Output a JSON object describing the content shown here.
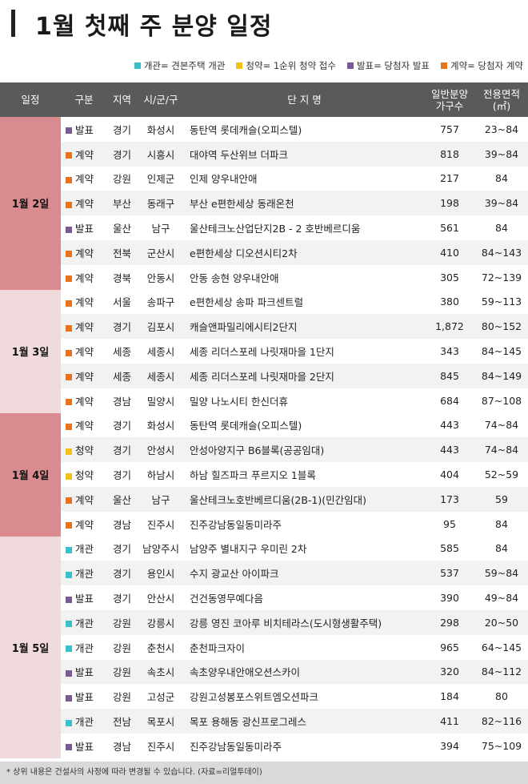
{
  "title": "1월 첫째 주 분양 일정",
  "legend": [
    {
      "text": "개관= 견본주택 개관",
      "color": "#3bbfc9"
    },
    {
      "text": "청약= 1순위 청약 접수",
      "color": "#f2c21b"
    },
    {
      "text": "발표= 당첨자 발표",
      "color": "#7b5a94"
    },
    {
      "text": "계약= 당첨자 계약",
      "color": "#e8731c"
    }
  ],
  "headers": {
    "date": "일정",
    "type": "구분",
    "region": "지역",
    "city": "시/군/구",
    "name": "단 지 명",
    "units_1": "일반분양",
    "units_2": "가구수",
    "area_1": "전용면적",
    "area_2": "(㎡)"
  },
  "type_colors": {
    "개관": "#3bbfc9",
    "청약": "#f2c21b",
    "발표": "#7b5a94",
    "계약": "#e8731c"
  },
  "groups": [
    {
      "date": "1월 2일",
      "rows": [
        {
          "type": "발표",
          "region": "경기",
          "city": "화성시",
          "name": "동탄역 롯데캐슬(오피스텔)",
          "units": "757",
          "area": "23~84"
        },
        {
          "type": "계약",
          "region": "경기",
          "city": "시흥시",
          "name": "대야역 두산위브 더파크",
          "units": "818",
          "area": "39~84"
        },
        {
          "type": "계약",
          "region": "강원",
          "city": "인제군",
          "name": "인제 양우내안애",
          "units": "217",
          "area": "84"
        },
        {
          "type": "계약",
          "region": "부산",
          "city": "동래구",
          "name": "부산 e편한세상 동래온천",
          "units": "198",
          "area": "39~84"
        },
        {
          "type": "발표",
          "region": "울산",
          "city": "남구",
          "name": "울산테크노산업단지2B - 2 호반베르디움",
          "units": "561",
          "area": "84"
        },
        {
          "type": "계약",
          "region": "전북",
          "city": "군산시",
          "name": "e편한세상 디오션시티2차",
          "units": "410",
          "area": "84~143"
        },
        {
          "type": "계약",
          "region": "경북",
          "city": "안동시",
          "name": "안동 송현 양우내안애",
          "units": "305",
          "area": "72~139"
        }
      ]
    },
    {
      "date": "1월 3일",
      "rows": [
        {
          "type": "계약",
          "region": "서울",
          "city": "송파구",
          "name": "e편한세상 송파 파크센트럴",
          "units": "380",
          "area": "59~113"
        },
        {
          "type": "계약",
          "region": "경기",
          "city": "김포시",
          "name": "캐슬앤파밀리에시티2단지",
          "units": "1,872",
          "area": "80~152"
        },
        {
          "type": "계약",
          "region": "세종",
          "city": "세종시",
          "name": "세종 리더스포레 나릿재마을 1단지",
          "units": "343",
          "area": "84~145"
        },
        {
          "type": "계약",
          "region": "세종",
          "city": "세종시",
          "name": "세종 리더스포레 나릿재마을 2단지",
          "units": "845",
          "area": "84~149"
        },
        {
          "type": "계약",
          "region": "경남",
          "city": "밀양시",
          "name": "밀양 나노시티 한신더휴",
          "units": "684",
          "area": "87~108"
        }
      ]
    },
    {
      "date": "1월 4일",
      "rows": [
        {
          "type": "계약",
          "region": "경기",
          "city": "화성시",
          "name": "동탄역 롯데캐슬(오피스텔)",
          "units": "443",
          "area": "74~84"
        },
        {
          "type": "청약",
          "region": "경기",
          "city": "안성시",
          "name": "안성아양지구 B6블록(공공임대)",
          "units": "443",
          "area": "74~84"
        },
        {
          "type": "청약",
          "region": "경기",
          "city": "하남시",
          "name": "하남 힐즈파크 푸르지오 1블록",
          "units": "404",
          "area": "52~59"
        },
        {
          "type": "계약",
          "region": "울산",
          "city": "남구",
          "name": "울산테크노호반베르디움(2B-1)(민간임대)",
          "units": "173",
          "area": "59"
        },
        {
          "type": "계약",
          "region": "경남",
          "city": "진주시",
          "name": "진주강남동일동미라주",
          "units": "95",
          "area": "84"
        }
      ]
    },
    {
      "date": "1월 5일",
      "rows": [
        {
          "type": "개관",
          "region": "경기",
          "city": "남양주시",
          "name": "남양주 별내지구 우미린 2차",
          "units": "585",
          "area": "84"
        },
        {
          "type": "개관",
          "region": "경기",
          "city": "용인시",
          "name": "수지 광교산 아이파크",
          "units": "537",
          "area": "59~84"
        },
        {
          "type": "발표",
          "region": "경기",
          "city": "안산시",
          "name": "건건동영무예다음",
          "units": "390",
          "area": "49~84"
        },
        {
          "type": "개관",
          "region": "강원",
          "city": "강릉시",
          "name": "강릉 영진 코아루 비치테라스(도시형생활주택)",
          "units": "298",
          "area": "20~50"
        },
        {
          "type": "개관",
          "region": "강원",
          "city": "춘천시",
          "name": "춘천파크자이",
          "units": "965",
          "area": "64~145"
        },
        {
          "type": "발표",
          "region": "강원",
          "city": "속초시",
          "name": "속초양우내안애오션스카이",
          "units": "320",
          "area": "84~112"
        },
        {
          "type": "발표",
          "region": "강원",
          "city": "고성군",
          "name": "강원고성봉포스위트엠오션파크",
          "units": "184",
          "area": "80"
        },
        {
          "type": "개관",
          "region": "전남",
          "city": "목포시",
          "name": "목포 용해동 광신프로그레스",
          "units": "411",
          "area": "82~116"
        },
        {
          "type": "발표",
          "region": "경남",
          "city": "진주시",
          "name": "진주강남동일동미라주",
          "units": "394",
          "area": "75~109"
        }
      ]
    }
  ],
  "footer": "* 상위 내용은 건설사의 사정에 따라 변경될 수 있습니다. (자료=리얼투데이)"
}
